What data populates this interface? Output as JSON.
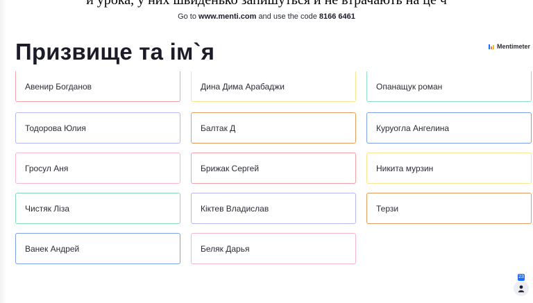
{
  "banner": {
    "text": "и урока, у них швиденько запишуться й не втрачають на це ч"
  },
  "join": {
    "prefix": "Go to",
    "url": "www.menti.com",
    "middle": "and use the code",
    "code": "8166 6461"
  },
  "slide": {
    "title": "Призвище та ім`я",
    "brand": "Mentimeter"
  },
  "colors": {
    "red": "#f4a2a6",
    "yellow": "#fde58f",
    "teal": "#8fdfc4",
    "lavender": "#b5b8ee",
    "orange": "#e59d5e",
    "blue": "#7f9fe3",
    "green": "#83e0b5",
    "pink": "#f6b6cf",
    "brand_logo": [
      "#196cff",
      "#ff7171",
      "#f5c100"
    ],
    "count_badge": "#196cff"
  },
  "responses": [
    {
      "text": "Авенир Богданов",
      "color": "red"
    },
    {
      "text": "Дина Дима Арабаджи",
      "color": "yellow"
    },
    {
      "text": "Опанащук роман",
      "color": "teal"
    },
    {
      "text": "Тодорова Юлия",
      "color": "lavender"
    },
    {
      "text": "Балтак Д",
      "color": "orange"
    },
    {
      "text": "Куруогла Ангелина",
      "color": "blue"
    },
    {
      "text": "Гросул Аня",
      "color": "pink"
    },
    {
      "text": "Брижак Сергей",
      "color": "red"
    },
    {
      "text": "Никита мурзин",
      "color": "yellow"
    },
    {
      "text": "Чистяк Ліза",
      "color": "green"
    },
    {
      "text": "Кіктев Владислав",
      "color": "lavender"
    },
    {
      "text": "Терзи",
      "color": "orange"
    },
    {
      "text": "Ванек Андрей",
      "color": "blue"
    },
    {
      "text": "Беляк Дарья",
      "color": "pink"
    }
  ],
  "participants": {
    "count": "23",
    "icon": "person-icon"
  }
}
